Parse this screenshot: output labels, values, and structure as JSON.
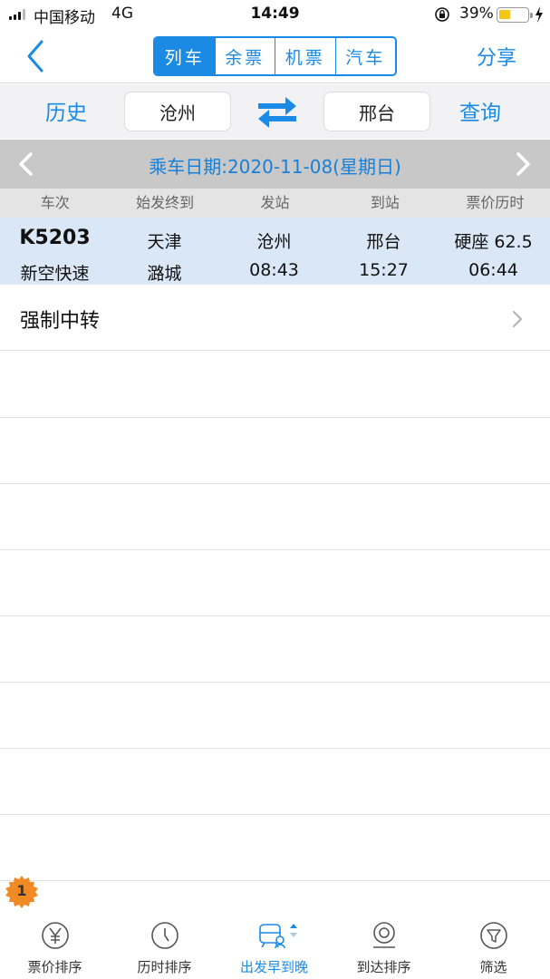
{
  "status": {
    "carrier": "中国移动",
    "network": "4G",
    "time": "14:49",
    "battery": "39%"
  },
  "nav": {
    "tabs": [
      {
        "label": "列车",
        "active": true
      },
      {
        "label": "余票",
        "active": false
      },
      {
        "label": "机票",
        "active": false
      },
      {
        "label": "汽车",
        "active": false
      }
    ],
    "share": "分享"
  },
  "search": {
    "history": "历史",
    "from": "沧州",
    "to": "邢台",
    "query": "查询"
  },
  "date_bar": {
    "text": "乘车日期:2020-11-08(星期日)"
  },
  "columns": [
    "车次",
    "始发终到",
    "发站",
    "到站",
    "票价历时"
  ],
  "trains": [
    {
      "number": "K5203",
      "company": "新空快速",
      "origin": "天津",
      "terminal": "潞城",
      "depart_station": "沧州",
      "depart_time": "08:43",
      "arrive_station": "邢台",
      "arrive_time": "15:27",
      "price": "硬座 62.5",
      "duration": "06:44"
    }
  ],
  "transfer": {
    "label": "强制中转"
  },
  "badge": "1",
  "toolbar": {
    "items": [
      {
        "label": "票价排序",
        "icon": "yen-icon",
        "active": false
      },
      {
        "label": "历时排序",
        "icon": "clock-icon",
        "active": false
      },
      {
        "label": "出发早到晚",
        "icon": "train-sort-icon",
        "active": true
      },
      {
        "label": "到达排序",
        "icon": "location-icon",
        "active": false
      },
      {
        "label": "筛选",
        "icon": "filter-icon",
        "active": false
      }
    ]
  },
  "colors": {
    "accent": "#1a8ae5",
    "row_highlight": "#d9e7f6",
    "badge": "#f08a24"
  }
}
